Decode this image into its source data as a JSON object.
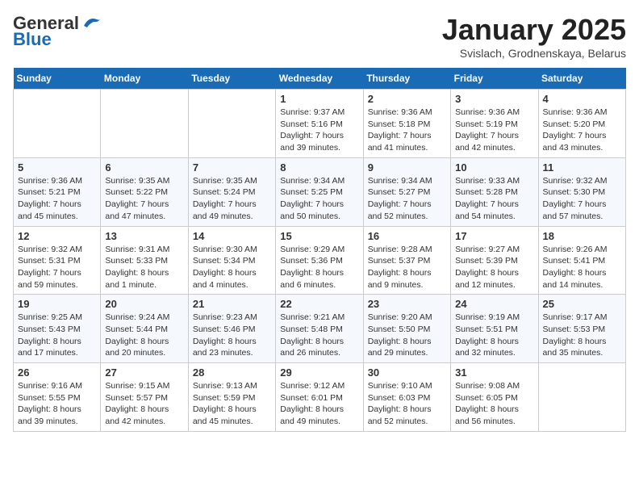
{
  "header": {
    "logo_general": "General",
    "logo_blue": "Blue",
    "title": "January 2025",
    "subtitle": "Svislach, Grodnenskaya, Belarus"
  },
  "weekdays": [
    "Sunday",
    "Monday",
    "Tuesday",
    "Wednesday",
    "Thursday",
    "Friday",
    "Saturday"
  ],
  "weeks": [
    [
      {
        "num": "",
        "text": ""
      },
      {
        "num": "",
        "text": ""
      },
      {
        "num": "",
        "text": ""
      },
      {
        "num": "1",
        "text": "Sunrise: 9:37 AM\nSunset: 5:16 PM\nDaylight: 7 hours\nand 39 minutes."
      },
      {
        "num": "2",
        "text": "Sunrise: 9:36 AM\nSunset: 5:18 PM\nDaylight: 7 hours\nand 41 minutes."
      },
      {
        "num": "3",
        "text": "Sunrise: 9:36 AM\nSunset: 5:19 PM\nDaylight: 7 hours\nand 42 minutes."
      },
      {
        "num": "4",
        "text": "Sunrise: 9:36 AM\nSunset: 5:20 PM\nDaylight: 7 hours\nand 43 minutes."
      }
    ],
    [
      {
        "num": "5",
        "text": "Sunrise: 9:36 AM\nSunset: 5:21 PM\nDaylight: 7 hours\nand 45 minutes."
      },
      {
        "num": "6",
        "text": "Sunrise: 9:35 AM\nSunset: 5:22 PM\nDaylight: 7 hours\nand 47 minutes."
      },
      {
        "num": "7",
        "text": "Sunrise: 9:35 AM\nSunset: 5:24 PM\nDaylight: 7 hours\nand 49 minutes."
      },
      {
        "num": "8",
        "text": "Sunrise: 9:34 AM\nSunset: 5:25 PM\nDaylight: 7 hours\nand 50 minutes."
      },
      {
        "num": "9",
        "text": "Sunrise: 9:34 AM\nSunset: 5:27 PM\nDaylight: 7 hours\nand 52 minutes."
      },
      {
        "num": "10",
        "text": "Sunrise: 9:33 AM\nSunset: 5:28 PM\nDaylight: 7 hours\nand 54 minutes."
      },
      {
        "num": "11",
        "text": "Sunrise: 9:32 AM\nSunset: 5:30 PM\nDaylight: 7 hours\nand 57 minutes."
      }
    ],
    [
      {
        "num": "12",
        "text": "Sunrise: 9:32 AM\nSunset: 5:31 PM\nDaylight: 7 hours\nand 59 minutes."
      },
      {
        "num": "13",
        "text": "Sunrise: 9:31 AM\nSunset: 5:33 PM\nDaylight: 8 hours\nand 1 minute."
      },
      {
        "num": "14",
        "text": "Sunrise: 9:30 AM\nSunset: 5:34 PM\nDaylight: 8 hours\nand 4 minutes."
      },
      {
        "num": "15",
        "text": "Sunrise: 9:29 AM\nSunset: 5:36 PM\nDaylight: 8 hours\nand 6 minutes."
      },
      {
        "num": "16",
        "text": "Sunrise: 9:28 AM\nSunset: 5:37 PM\nDaylight: 8 hours\nand 9 minutes."
      },
      {
        "num": "17",
        "text": "Sunrise: 9:27 AM\nSunset: 5:39 PM\nDaylight: 8 hours\nand 12 minutes."
      },
      {
        "num": "18",
        "text": "Sunrise: 9:26 AM\nSunset: 5:41 PM\nDaylight: 8 hours\nand 14 minutes."
      }
    ],
    [
      {
        "num": "19",
        "text": "Sunrise: 9:25 AM\nSunset: 5:43 PM\nDaylight: 8 hours\nand 17 minutes."
      },
      {
        "num": "20",
        "text": "Sunrise: 9:24 AM\nSunset: 5:44 PM\nDaylight: 8 hours\nand 20 minutes."
      },
      {
        "num": "21",
        "text": "Sunrise: 9:23 AM\nSunset: 5:46 PM\nDaylight: 8 hours\nand 23 minutes."
      },
      {
        "num": "22",
        "text": "Sunrise: 9:21 AM\nSunset: 5:48 PM\nDaylight: 8 hours\nand 26 minutes."
      },
      {
        "num": "23",
        "text": "Sunrise: 9:20 AM\nSunset: 5:50 PM\nDaylight: 8 hours\nand 29 minutes."
      },
      {
        "num": "24",
        "text": "Sunrise: 9:19 AM\nSunset: 5:51 PM\nDaylight: 8 hours\nand 32 minutes."
      },
      {
        "num": "25",
        "text": "Sunrise: 9:17 AM\nSunset: 5:53 PM\nDaylight: 8 hours\nand 35 minutes."
      }
    ],
    [
      {
        "num": "26",
        "text": "Sunrise: 9:16 AM\nSunset: 5:55 PM\nDaylight: 8 hours\nand 39 minutes."
      },
      {
        "num": "27",
        "text": "Sunrise: 9:15 AM\nSunset: 5:57 PM\nDaylight: 8 hours\nand 42 minutes."
      },
      {
        "num": "28",
        "text": "Sunrise: 9:13 AM\nSunset: 5:59 PM\nDaylight: 8 hours\nand 45 minutes."
      },
      {
        "num": "29",
        "text": "Sunrise: 9:12 AM\nSunset: 6:01 PM\nDaylight: 8 hours\nand 49 minutes."
      },
      {
        "num": "30",
        "text": "Sunrise: 9:10 AM\nSunset: 6:03 PM\nDaylight: 8 hours\nand 52 minutes."
      },
      {
        "num": "31",
        "text": "Sunrise: 9:08 AM\nSunset: 6:05 PM\nDaylight: 8 hours\nand 56 minutes."
      },
      {
        "num": "",
        "text": ""
      }
    ]
  ]
}
